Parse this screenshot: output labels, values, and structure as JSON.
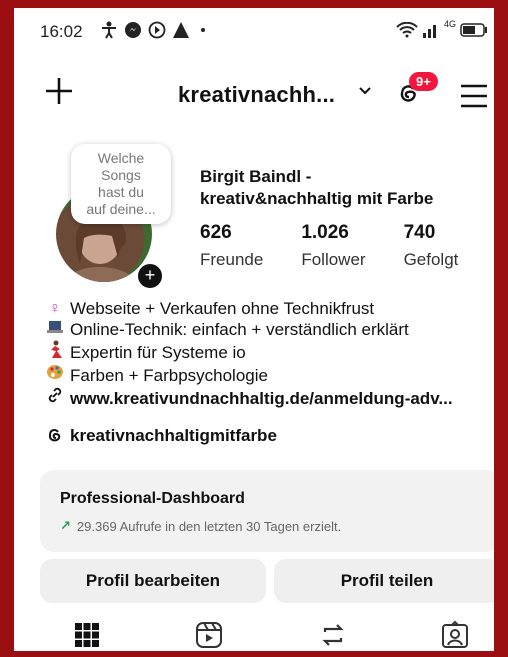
{
  "status": {
    "time": "16:02",
    "network": "4G"
  },
  "top_bar": {
    "username": "kreativnachh...",
    "notification_count": "9+"
  },
  "profile": {
    "note": [
      "Welche",
      "Songs",
      "hast du",
      "auf deine..."
    ],
    "name_line1": "Birgit Baindl -",
    "name_line2": "kreativ&nachhaltig mit Farbe",
    "stats": [
      {
        "value": "626",
        "label": "Freunde"
      },
      {
        "value": "1.026",
        "label": "Follower"
      },
      {
        "value": "740",
        "label": "Gefolgt"
      }
    ],
    "bio": [
      {
        "icon": "♀",
        "text": "Webseite + Verkaufen ohne Technikfrust"
      },
      {
        "icon": "💻",
        "text": "Online-Technik: einfach + verständlich erklärt"
      },
      {
        "icon": "💃",
        "text": "Expertin für Systeme io"
      },
      {
        "icon": "🎨",
        "text": "Farben + Farbpsychologie"
      }
    ],
    "link": "www.kreativundnachhaltig.de/anmeldung-adv...",
    "threads_handle": "kreativnachhaltigmitfarbe"
  },
  "dashboard": {
    "title": "Professional-Dashboard",
    "arrow": "↗",
    "subtitle": "29.369 Aufrufe in den letzten 30 Tagen erzielt."
  },
  "buttons": {
    "edit": "Profil bearbeiten",
    "share": "Profil teilen"
  },
  "colors": {
    "frame": "#9b0f12",
    "badge": "#f3163e",
    "accent_green": "#2a9d53"
  }
}
